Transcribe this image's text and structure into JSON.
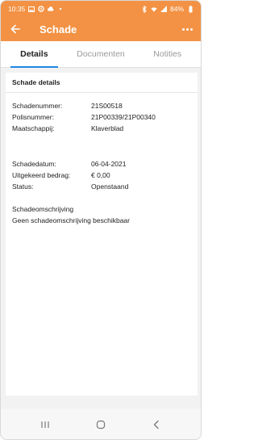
{
  "status_bar": {
    "time": "10:35",
    "battery": "84%",
    "left_icons": [
      "gallery-icon",
      "settings-icon",
      "cloud-icon",
      "dot-icon"
    ],
    "right_icons": [
      "bluetooth-icon",
      "wifi-icon",
      "signal-icon",
      "battery-icon"
    ]
  },
  "app_bar": {
    "title": "Schade",
    "back_icon": "arrow-left-icon",
    "menu_icon": "more-horizontal-icon"
  },
  "tabs": [
    {
      "label": "Details",
      "active": true
    },
    {
      "label": "Documenten",
      "active": false
    },
    {
      "label": "Notities",
      "active": false
    }
  ],
  "card": {
    "title": "Schade details",
    "fields": [
      {
        "label": "Schadenummer:",
        "value": "21S00518"
      },
      {
        "label": "Polisnummer:",
        "value": "21P00339/21P00340"
      },
      {
        "label": "Maatschappij:",
        "value": "Klaverblad"
      },
      {
        "label": "Schadedatum:",
        "value": "06-04-2021"
      },
      {
        "label": "Uitgekeerd bedrag:",
        "value": "€ 0,00"
      },
      {
        "label": "Status:",
        "value": "Openstaand"
      }
    ],
    "description_label": "Schadeomschrijving",
    "description_value": "Geen schadeomschrijving beschikbaar"
  },
  "nav_bar": {
    "buttons": [
      "recent-apps-icon",
      "home-icon",
      "back-nav-icon"
    ]
  },
  "colors": {
    "primary": "#f39244",
    "tab_indicator": "#1e88e5",
    "background": "#f2f2f2"
  }
}
